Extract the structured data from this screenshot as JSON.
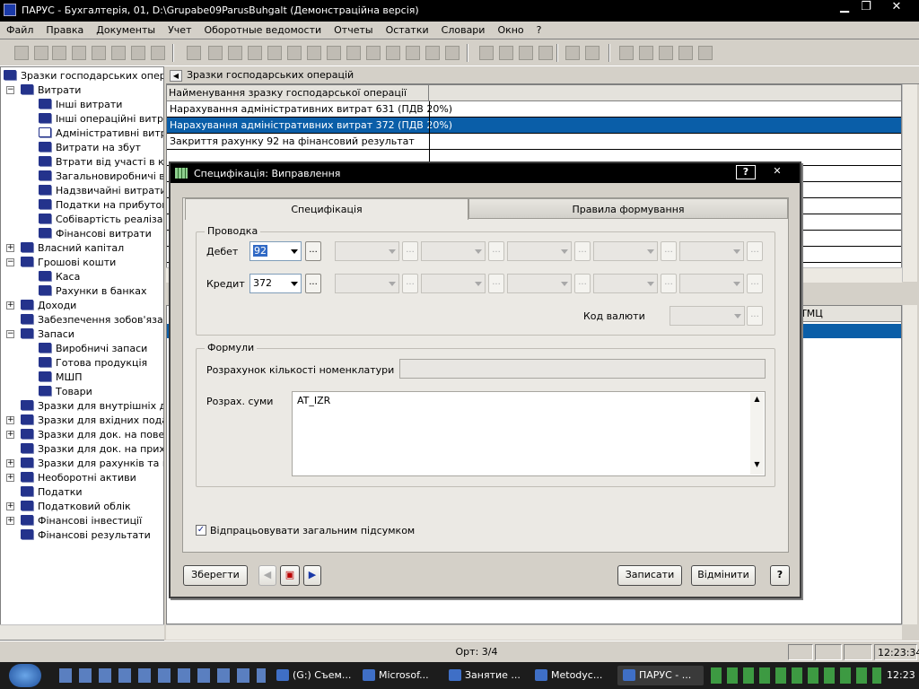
{
  "window": {
    "title": "ПАРУС - Бухгалтерія, 01, D:\\Grupabe09ParusBuhgalt (Демонстраційна версія)",
    "min": "▁",
    "max": "❐",
    "close": "✕"
  },
  "menu": [
    "Файл",
    "Правка",
    "Документы",
    "Учет",
    "Оборотные ведомости",
    "Отчеты",
    "Остатки",
    "Словари",
    "Окно",
    "?"
  ],
  "tree": {
    "root": "Зразки господарських операц",
    "items": [
      {
        "label": "Витрати",
        "level": 1,
        "expand": "−"
      },
      {
        "label": "Інші витрати",
        "level": 2
      },
      {
        "label": "Інші операційні витрати",
        "level": 2
      },
      {
        "label": "Адміністративні витрат",
        "level": 2,
        "open": true
      },
      {
        "label": "Витрати на збут",
        "level": 2
      },
      {
        "label": "Втрати від участі в капі",
        "level": 2
      },
      {
        "label": "Загальновиробничі вит",
        "level": 2
      },
      {
        "label": "Надзвичайні витрати",
        "level": 2
      },
      {
        "label": "Податки на прибуток",
        "level": 2
      },
      {
        "label": "Собівартість реалізації",
        "level": 2
      },
      {
        "label": "Фінансові витрати",
        "level": 2
      },
      {
        "label": "Власний капітал",
        "level": 1,
        "expand": "+"
      },
      {
        "label": "Грошові кошти",
        "level": 1,
        "expand": "−"
      },
      {
        "label": "Каса",
        "level": 2
      },
      {
        "label": "Рахунки в банках",
        "level": 2
      },
      {
        "label": "Доходи",
        "level": 1,
        "expand": "+"
      },
      {
        "label": "Забезпечення зобов'язань",
        "level": 1
      },
      {
        "label": "Запаси",
        "level": 1,
        "expand": "−"
      },
      {
        "label": "Виробничі запаси",
        "level": 2
      },
      {
        "label": "Готова продукція",
        "level": 2
      },
      {
        "label": "МШП",
        "level": 2
      },
      {
        "label": "Товари",
        "level": 2
      },
      {
        "label": "Зразки для внутрішніх доку",
        "level": 1
      },
      {
        "label": "Зразки для вхідних подат.",
        "level": 1,
        "expand": "+"
      },
      {
        "label": "Зразки для док. на повер.",
        "level": 1,
        "expand": "+"
      },
      {
        "label": "Зразки для док. на приход",
        "level": 1
      },
      {
        "label": "Зразки для рахунків та нак",
        "level": 1,
        "expand": "+"
      },
      {
        "label": "Необоротні активи",
        "level": 1,
        "expand": "+"
      },
      {
        "label": "Податки",
        "level": 1
      },
      {
        "label": "Податковий облік",
        "level": 1,
        "expand": "+"
      },
      {
        "label": "Фінансові інвестиції",
        "level": 1,
        "expand": "+"
      },
      {
        "label": "Фінансові результати",
        "level": 1
      }
    ]
  },
  "panel": {
    "header": "Зразки господарських операцій",
    "column": "Найменування зразку господарської операції",
    "rows": [
      {
        "text": "Нарахування адміністративних витрат 631 (ПДВ 20%)",
        "selected": false
      },
      {
        "text": "Нарахування адміністративних витрат 372 (ПДВ 20%)",
        "selected": true
      },
      {
        "text": "Закриття рахунку 92 на фінансовий результат",
        "selected": false
      }
    ],
    "lower_col": "ТМЦ"
  },
  "dialog": {
    "title": "Специфікація: Виправлення",
    "help": "?",
    "close": "✕",
    "tabs": [
      "Специфікація",
      "Правила формування"
    ],
    "posting_group": "Проводка",
    "debit_label": "Дебет",
    "debit_value": "92",
    "credit_label": "Кредит",
    "credit_value": "372",
    "currency_label": "Код валюти",
    "dots": "...",
    "formulas_group": "Формули",
    "qty_label": "Розрахунок кількості номенклатури",
    "sum_label": "Розрах. суми",
    "sum_value": "AT_IZR",
    "checkbox_label": "Відпрацьовувати загальним підсумком",
    "checkbox_checked": true,
    "save_btn": "Зберегти",
    "write_btn": "Записати",
    "cancel_btn": "Відмінити",
    "help_btn": "?"
  },
  "status": {
    "record": "Орт: 3/4",
    "time": "12:23:34"
  },
  "taskbar": {
    "tasks": [
      "(G:) Съем...",
      "Microsof...",
      "Занятие ...",
      "Metodyc...",
      "ПАРУС - ..."
    ],
    "clock": "12:23"
  }
}
